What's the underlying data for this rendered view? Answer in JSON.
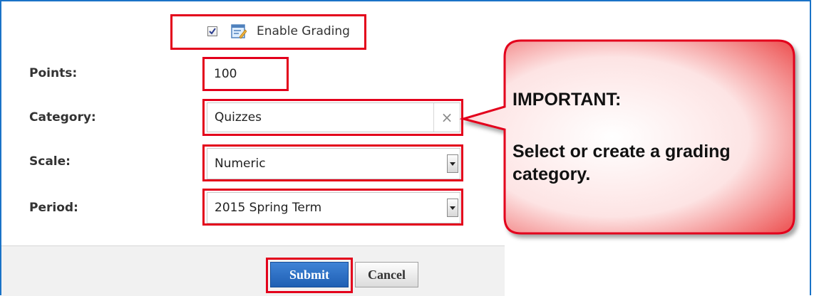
{
  "grading": {
    "enable_label": "Enable Grading",
    "enabled": true
  },
  "form": {
    "points_label": "Points:",
    "points_value": "100",
    "category_label": "Category:",
    "category_value": "Quizzes",
    "category_clear": "×",
    "scale_label": "Scale:",
    "scale_value": "Numeric",
    "period_label": "Period:",
    "period_value": "2015 Spring Term"
  },
  "actions": {
    "submit_label": "Submit",
    "cancel_label": "Cancel"
  },
  "callout": {
    "heading": "IMPORTANT:",
    "line1": "Select or create a grading",
    "line2": "category."
  },
  "colors": {
    "highlight": "#e3001b",
    "frame": "#1a73c7",
    "submit": "#2a6cc4"
  }
}
